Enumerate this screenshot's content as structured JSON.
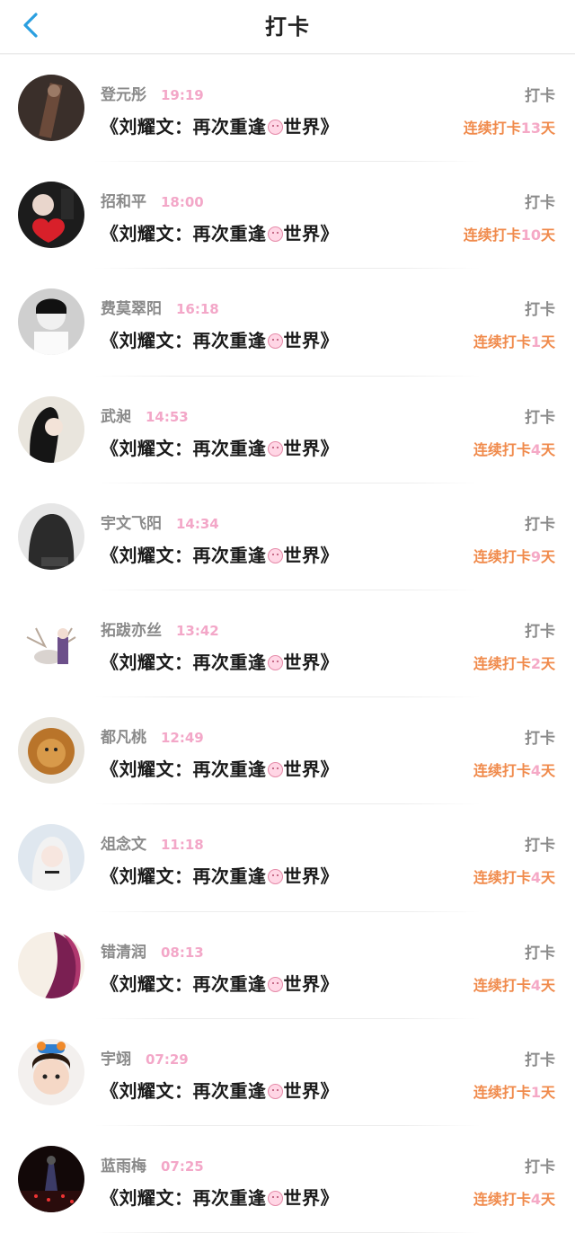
{
  "header": {
    "title": "打卡",
    "back_icon": "chevron-left-icon",
    "accent": "#2a9fe0"
  },
  "colors": {
    "streak": "#f08a4b",
    "time": "#f3a7c8",
    "name": "#8a8a8a"
  },
  "items": [
    {
      "name": "登元彤",
      "time": "19:19",
      "content_before": "《刘耀文：再次重逢",
      "content_after": "世界》",
      "action": "打卡",
      "streak_prefix": "连续打卡",
      "streak_count": "13",
      "streak_suffix": "天"
    },
    {
      "name": "招和平",
      "time": "18:00",
      "content_before": "《刘耀文：再次重逢",
      "content_after": "世界》",
      "action": "打卡",
      "streak_prefix": "连续打卡",
      "streak_count": "10",
      "streak_suffix": "天"
    },
    {
      "name": "费莫翠阳",
      "time": "16:18",
      "content_before": "《刘耀文：再次重逢",
      "content_after": "世界》",
      "action": "打卡",
      "streak_prefix": "连续打卡",
      "streak_count": "1",
      "streak_suffix": "天"
    },
    {
      "name": "武昶",
      "time": "14:53",
      "content_before": "《刘耀文：再次重逢",
      "content_after": "世界》",
      "action": "打卡",
      "streak_prefix": "连续打卡",
      "streak_count": "4",
      "streak_suffix": "天"
    },
    {
      "name": "宇文飞阳",
      "time": "14:34",
      "content_before": "《刘耀文：再次重逢",
      "content_after": "世界》",
      "action": "打卡",
      "streak_prefix": "连续打卡",
      "streak_count": "9",
      "streak_suffix": "天"
    },
    {
      "name": "拓跋亦丝",
      "time": "13:42",
      "content_before": "《刘耀文：再次重逢",
      "content_after": "世界》",
      "action": "打卡",
      "streak_prefix": "连续打卡",
      "streak_count": "2",
      "streak_suffix": "天"
    },
    {
      "name": "都凡桃",
      "time": "12:49",
      "content_before": "《刘耀文：再次重逢",
      "content_after": "世界》",
      "action": "打卡",
      "streak_prefix": "连续打卡",
      "streak_count": "4",
      "streak_suffix": "天"
    },
    {
      "name": "俎念文",
      "time": "11:18",
      "content_before": "《刘耀文：再次重逢",
      "content_after": "世界》",
      "action": "打卡",
      "streak_prefix": "连续打卡",
      "streak_count": "4",
      "streak_suffix": "天"
    },
    {
      "name": "错清润",
      "time": "08:13",
      "content_before": "《刘耀文：再次重逢",
      "content_after": "世界》",
      "action": "打卡",
      "streak_prefix": "连续打卡",
      "streak_count": "4",
      "streak_suffix": "天"
    },
    {
      "name": "宇翊",
      "time": "07:29",
      "content_before": "《刘耀文：再次重逢",
      "content_after": "世界》",
      "action": "打卡",
      "streak_prefix": "连续打卡",
      "streak_count": "1",
      "streak_suffix": "天"
    },
    {
      "name": "蓝雨梅",
      "time": "07:25",
      "content_before": "《刘耀文：再次重逢",
      "content_after": "世界》",
      "action": "打卡",
      "streak_prefix": "连续打卡",
      "streak_count": "4",
      "streak_suffix": "天"
    }
  ]
}
